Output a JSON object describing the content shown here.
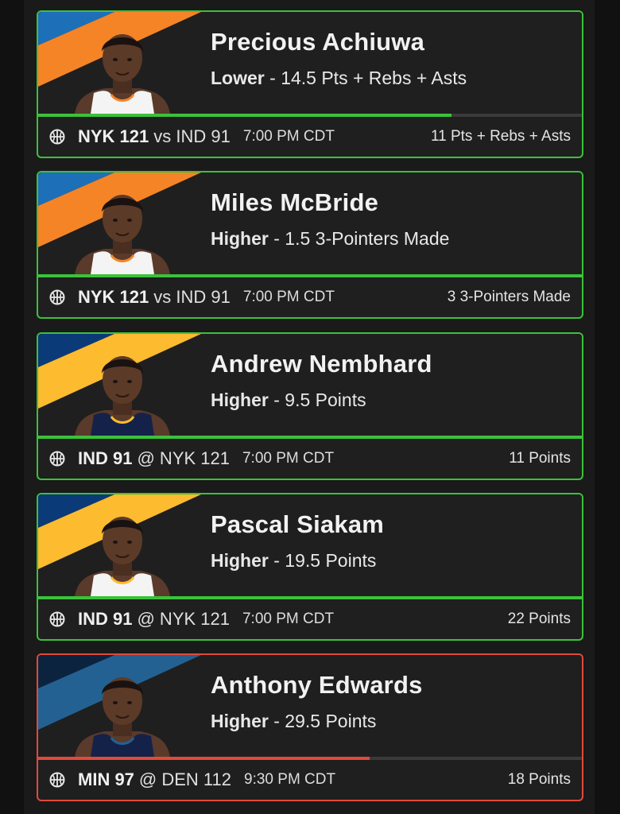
{
  "cards": [
    {
      "player": "Precious Achiuwa",
      "direction": "Lower",
      "line": "14.5 Pts + Rebs + Asts",
      "team_score": "NYK 121",
      "matchup": "vs IND 91",
      "time": "7:00 PM CDT",
      "result": "11 Pts + Rebs + Asts",
      "progress": 0.76,
      "status": "hit",
      "team_colors": {
        "primary": "#f58426",
        "secondary": "#1d6fb8"
      },
      "jersey": "white"
    },
    {
      "player": "Miles McBride",
      "direction": "Higher",
      "line": "1.5 3-Pointers Made",
      "team_score": "NYK 121",
      "matchup": "vs IND 91",
      "time": "7:00 PM CDT",
      "result": "3 3-Pointers Made",
      "progress": 1.0,
      "status": "hit",
      "team_colors": {
        "primary": "#f58426",
        "secondary": "#1d6fb8"
      },
      "jersey": "white"
    },
    {
      "player": "Andrew Nembhard",
      "direction": "Higher",
      "line": "9.5 Points",
      "team_score": "IND 91",
      "matchup": "@ NYK 121",
      "time": "7:00 PM CDT",
      "result": "11 Points",
      "progress": 1.0,
      "status": "hit",
      "team_colors": {
        "primary": "#fdbb30",
        "secondary": "#0b3a78"
      },
      "jersey": "navy"
    },
    {
      "player": "Pascal Siakam",
      "direction": "Higher",
      "line": "19.5 Points",
      "team_score": "IND 91",
      "matchup": "@ NYK 121",
      "time": "7:00 PM CDT",
      "result": "22 Points",
      "progress": 1.0,
      "status": "hit",
      "team_colors": {
        "primary": "#fdbb30",
        "secondary": "#0b3a78"
      },
      "jersey": "white"
    },
    {
      "player": "Anthony Edwards",
      "direction": "Higher",
      "line": "29.5 Points",
      "team_score": "MIN 97",
      "matchup": "@ DEN 112",
      "time": "9:30 PM CDT",
      "result": "18 Points",
      "progress": 0.61,
      "status": "miss",
      "team_colors": {
        "primary": "#236192",
        "secondary": "#0c2340"
      },
      "jersey": "navy"
    }
  ],
  "colors": {
    "hit": "#3ac23a",
    "miss": "#e04a3a",
    "background": "#1c1c1c"
  }
}
